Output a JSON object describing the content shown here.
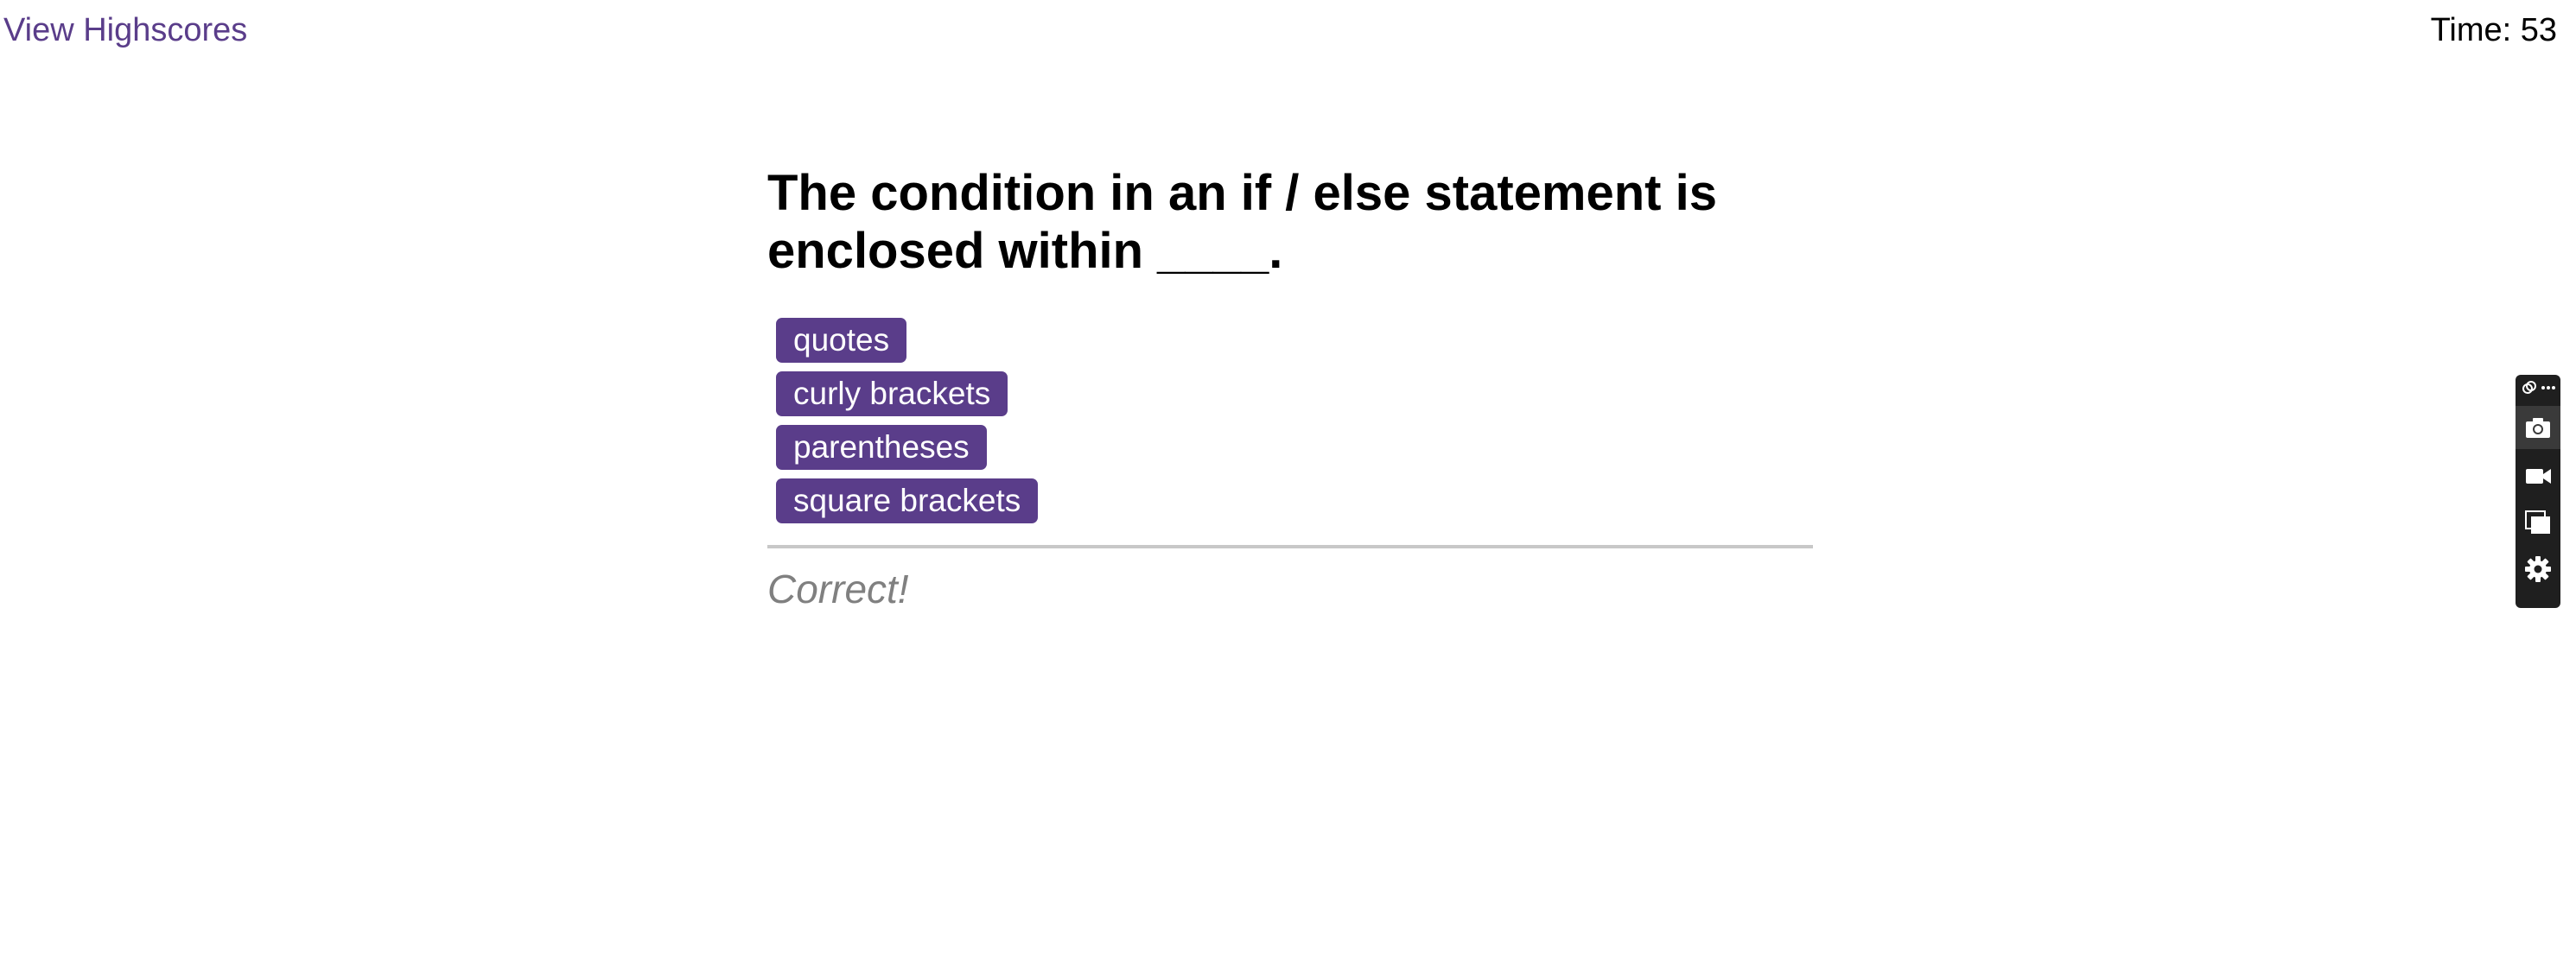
{
  "header": {
    "highscores_link": "View Highscores",
    "timer": "Time: 53"
  },
  "quiz": {
    "question": "The condition in an if / else statement is enclosed within ____.",
    "choices": [
      "quotes",
      "curly brackets",
      "parentheses",
      "square brackets"
    ],
    "feedback": "Correct!"
  },
  "widget": {
    "icons": [
      "link-icon",
      "more-icon",
      "camera-icon",
      "video-icon",
      "window-icon",
      "gear-icon"
    ]
  },
  "colors": {
    "accent": "#5a3d8a",
    "feedback_text": "#808080",
    "divider": "#c8c8c8",
    "widget_bg": "#1f1f1f"
  }
}
